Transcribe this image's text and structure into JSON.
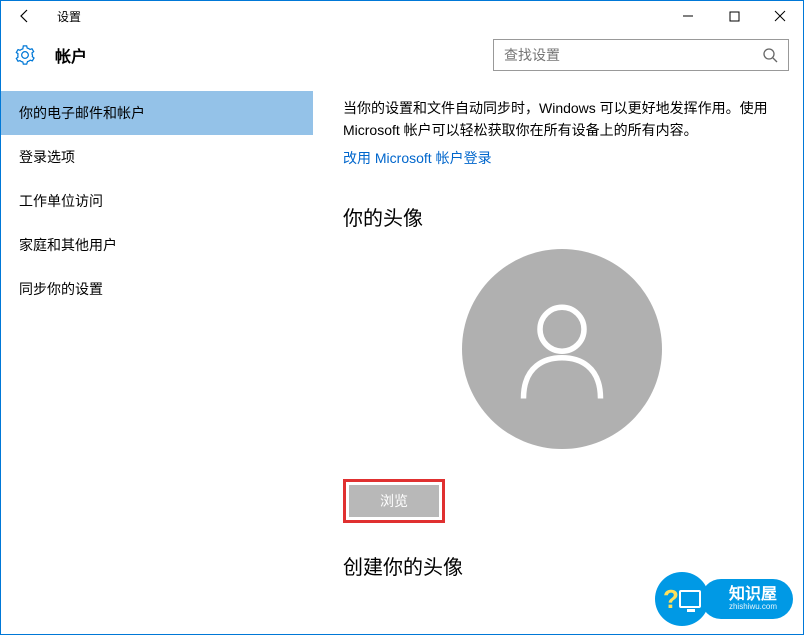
{
  "window": {
    "title": "设置"
  },
  "header": {
    "page_title": "帐户"
  },
  "search": {
    "placeholder": "查找设置"
  },
  "sidebar": {
    "items": [
      {
        "label": "你的电子邮件和帐户"
      },
      {
        "label": "登录选项"
      },
      {
        "label": "工作单位访问"
      },
      {
        "label": "家庭和其他用户"
      },
      {
        "label": "同步你的设置"
      }
    ]
  },
  "content": {
    "description": "当你的设置和文件自动同步时，Windows 可以更好地发挥作用。使用 Microsoft 帐户可以轻松获取你在所有设备上的所有内容。",
    "ms_link": "改用 Microsoft 帐户登录",
    "avatar_heading": "你的头像",
    "browse_label": "浏览",
    "create_heading": "创建你的头像"
  },
  "watermark": {
    "text": "知识屋",
    "sub": "zhishiwu.com"
  }
}
